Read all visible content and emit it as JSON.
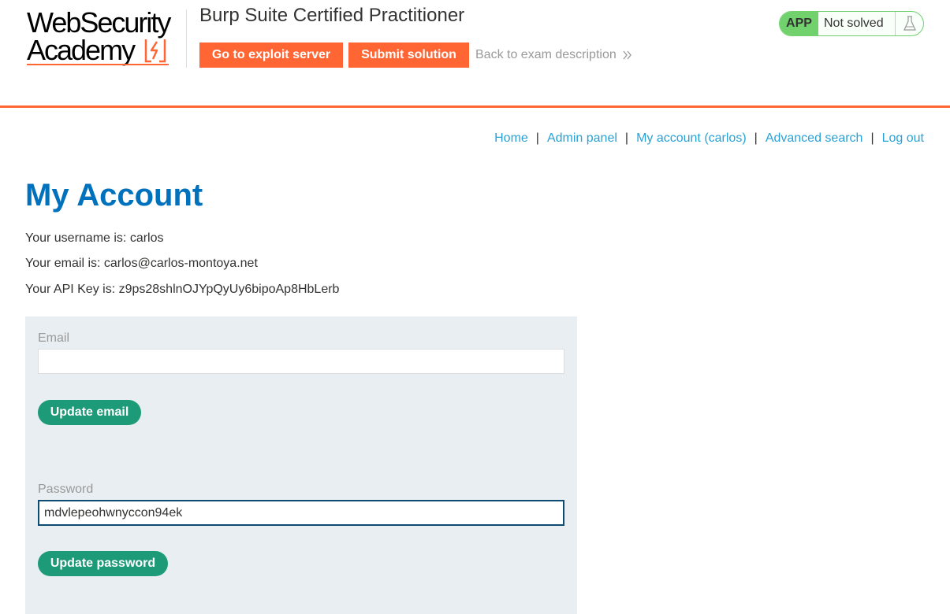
{
  "logo": {
    "line1": "WebSecurity",
    "line2": "Academy",
    "mark_icon": "lightning-bracket-icon"
  },
  "header": {
    "lab_title": "Burp Suite Certified Practitioner",
    "exploit_button": "Go to exploit server",
    "submit_button": "Submit solution",
    "back_link": "Back to exam description",
    "back_icon": "double-chevron-right-icon"
  },
  "status": {
    "badge": "APP",
    "text": "Not solved",
    "icon": "flask-icon"
  },
  "nav": {
    "home": "Home",
    "admin_panel": "Admin panel",
    "my_account": "My account (carlos)",
    "advanced_search": "Advanced search",
    "log_out": "Log out",
    "separator": "|"
  },
  "main": {
    "title": "My Account",
    "username_line": "Your username is: carlos",
    "email_line": "Your email is: carlos@carlos-montoya.net",
    "apikey_line": "Your API Key is: z9ps28shlnOJYpQyUy6bipoAp8HbLerb"
  },
  "form": {
    "email_label": "Email",
    "email_value": "",
    "update_email_button": "Update email",
    "password_label": "Password",
    "password_value": "mdvlepeohwnyccon94ek",
    "update_password_button": "Update password"
  },
  "colors": {
    "brand_orange": "#ff6633",
    "title_blue": "#0071bc",
    "link_blue": "#29a3d6",
    "button_green": "#1d9a77",
    "status_green": "#70d16d",
    "panel_bg": "#e8eef1"
  }
}
